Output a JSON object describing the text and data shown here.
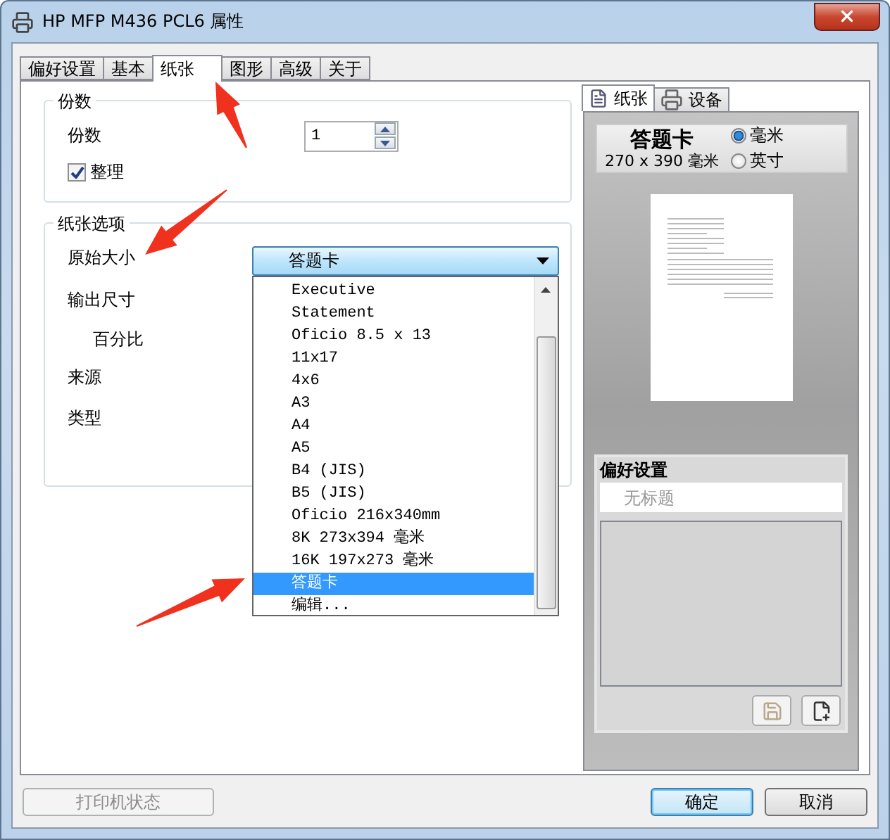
{
  "window": {
    "title": "HP MFP M436 PCL6 属性"
  },
  "tabs": [
    {
      "label": "偏好设置",
      "selected": false
    },
    {
      "label": "基本",
      "selected": false
    },
    {
      "label": "纸张",
      "selected": true
    },
    {
      "label": "图形",
      "selected": false
    },
    {
      "label": "高级",
      "selected": false
    },
    {
      "label": "关于",
      "selected": false
    }
  ],
  "copies": {
    "group_title": "份数",
    "label": "份数",
    "value": "1",
    "collate": {
      "label": "整理",
      "checked": true
    }
  },
  "paper_options": {
    "group_title": "纸张选项",
    "fields": [
      {
        "label": "原始大小"
      },
      {
        "label": "输出尺寸",
        "children": [
          {
            "label": "百分比"
          }
        ]
      },
      {
        "label": "来源"
      },
      {
        "label": "类型"
      }
    ]
  },
  "paper_size": {
    "value": "答题卡",
    "expanded": true,
    "options": [
      {
        "label": "Executive",
        "selected": false
      },
      {
        "label": "Statement",
        "selected": false
      },
      {
        "label": "Oficio 8.5 x 13",
        "selected": false
      },
      {
        "label": "11x17",
        "selected": false
      },
      {
        "label": "4x6",
        "selected": false
      },
      {
        "label": "A3",
        "selected": false
      },
      {
        "label": "A4",
        "selected": false
      },
      {
        "label": "A5",
        "selected": false
      },
      {
        "label": "B4 (JIS)",
        "selected": false
      },
      {
        "label": "B5 (JIS)",
        "selected": false
      },
      {
        "label": "Oficio 216x340mm",
        "selected": false
      },
      {
        "label": "8K 273x394 毫米",
        "selected": false
      },
      {
        "label": "16K 197x273 毫米",
        "selected": false
      },
      {
        "label": "答题卡",
        "selected": true
      },
      {
        "label": "编辑...",
        "selected": false
      }
    ]
  },
  "preview": {
    "tabs": [
      {
        "label": "纸张",
        "selected": true
      },
      {
        "label": "设备",
        "selected": false
      }
    ],
    "paper_name": "答题卡",
    "dimensions": "270 x 390 毫米",
    "units": [
      {
        "label": "毫米",
        "selected": true
      },
      {
        "label": "英寸",
        "selected": false
      }
    ]
  },
  "preferences": {
    "title": "偏好设置",
    "name_placeholder": "无标题"
  },
  "buttons": {
    "status": {
      "label": "打印机状态",
      "disabled": true
    },
    "ok": {
      "label": "确定"
    },
    "cancel": {
      "label": "取消"
    }
  }
}
